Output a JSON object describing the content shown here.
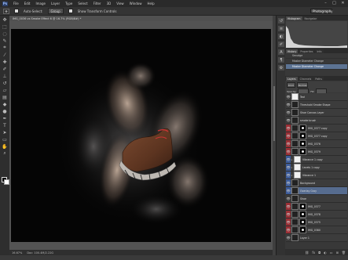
{
  "app": {
    "logo": "Ps",
    "menu": [
      "File",
      "Edit",
      "Image",
      "Layer",
      "Type",
      "Select",
      "Filter",
      "3D",
      "View",
      "Window",
      "Help"
    ],
    "window_controls": [
      "–",
      "□",
      "✕"
    ]
  },
  "options_bar": {
    "tool": "move-icon",
    "auto_select_label": "Auto-Select:",
    "auto_select_value": "Group",
    "transform_label": "Show Transform Controls",
    "workspace": "Photography"
  },
  "document": {
    "tab_title": "IMG_0036 vs Smoke Effect 6 @ 16.7% (RGB/8#) *",
    "zoom": "16.67%",
    "doc_size": "Doc: 100.4M/2.22G"
  },
  "panels": {
    "top_tabs": [
      "Histogram",
      "Navigator"
    ],
    "history_tabs": [
      "History",
      "Properties",
      "Info"
    ],
    "history_items": [
      "Smudge",
      "Master Diameter Change",
      "Master Diameter Change"
    ],
    "layers_tabs": [
      "Layers",
      "Channels",
      "Paths"
    ],
    "kind_label": "Kind",
    "blend_mode": "Normal",
    "opacity_label": "Opacity:",
    "fill_label": "Fill:",
    "layers": [
      {
        "name": "Text",
        "color": "none",
        "thumb": "white"
      },
      {
        "name": "Threshold Smoke Shape",
        "color": "none",
        "thumb": "dark"
      },
      {
        "name": "Shoe Canvas Layer",
        "color": "none",
        "thumb": "dark"
      },
      {
        "name": "smoke brush",
        "color": "none",
        "thumb": "dark"
      },
      {
        "name": "IMG_0377 copy",
        "color": "red",
        "thumb": "mask"
      },
      {
        "name": "IMG_0377 copy",
        "color": "red",
        "thumb": "mask"
      },
      {
        "name": "IMG_0376",
        "color": "red",
        "thumb": "mask"
      },
      {
        "name": "IMG_0379",
        "color": "red",
        "thumb": "mask"
      },
      {
        "name": "Vibrance 1 copy",
        "color": "blue",
        "thumb": "white"
      },
      {
        "name": "Levels 1 copy",
        "color": "blue",
        "thumb": "white"
      },
      {
        "name": "Vibrance 1",
        "color": "blue",
        "thumb": "white"
      },
      {
        "name": "Background",
        "color": "blue",
        "thumb": "dark"
      },
      {
        "name": "Overlay Gray",
        "color": "blue",
        "thumb": "dark"
      },
      {
        "name": "Shoe",
        "color": "none",
        "thumb": "dark"
      },
      {
        "name": "IMG_0377",
        "color": "red",
        "thumb": "mask"
      },
      {
        "name": "IMG_0378",
        "color": "red",
        "thumb": "mask"
      },
      {
        "name": "IMG_0375",
        "color": "red",
        "thumb": "mask"
      },
      {
        "name": "IMG_0380",
        "color": "red",
        "thumb": "mask"
      },
      {
        "name": "Layer 1",
        "color": "none",
        "thumb": "dark"
      }
    ]
  }
}
